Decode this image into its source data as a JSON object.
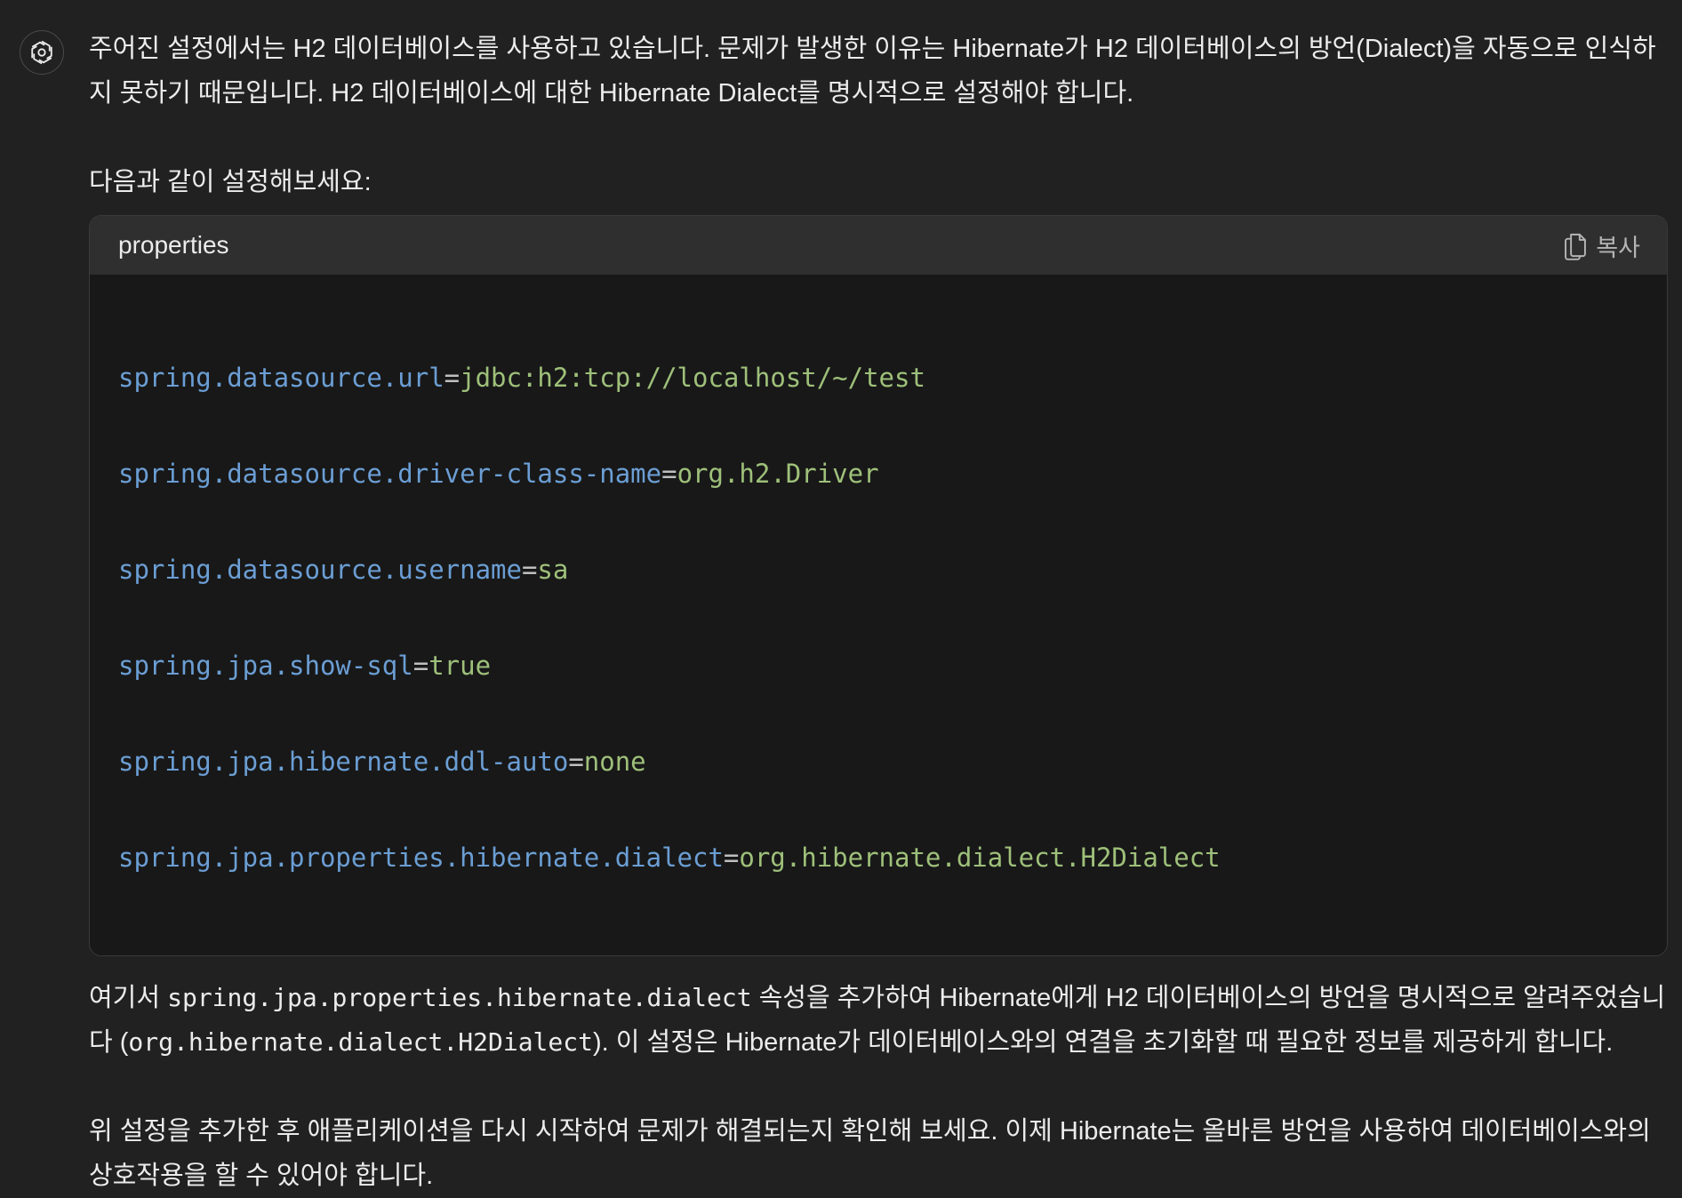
{
  "avatar": {
    "icon": "openai-logo-icon"
  },
  "message": {
    "para1": "주어진 설정에서는 H2 데이터베이스를 사용하고 있습니다. 문제가 발생한 이유는 Hibernate가 H2 데이터베이스의 방언(Dialect)을 자동으로 인식하지 못하기 때문입니다. H2 데이터베이스에 대한 Hibernate Dialect를 명시적으로 설정해야 합니다.",
    "para2": "다음과 같이 설정해보세요:",
    "para3_part1": "여기서 ",
    "para3_code1": "spring.jpa.properties.hibernate.dialect",
    "para3_part2": " 속성을 추가하여 Hibernate에게 H2 데이터베이스의 방언을 명시적으로 알려주었습니다 (",
    "para3_code2": "org.hibernate.dialect.H2Dialect",
    "para3_part3": "). 이 설정은 Hibernate가 데이터베이스와의 연결을 초기화할 때 필요한 정보를 제공하게 합니다.",
    "para4": "위 설정을 추가한 후 애플리케이션을 다시 시작하여 문제가 해결되는지 확인해 보세요. 이제 Hibernate는 올바른 방언을 사용하여 데이터베이스와의 상호작용을 할 수 있어야 합니다."
  },
  "code_block": {
    "language": "properties",
    "copy_label": "복사",
    "lines": [
      {
        "key": "spring.datasource.url",
        "eq": "=",
        "value": "jdbc:h2:tcp://localhost/~/test"
      },
      {
        "key": "spring.datasource.driver-class-name",
        "eq": "=",
        "value": "org.h2.Driver"
      },
      {
        "key": "spring.datasource.username",
        "eq": "=",
        "value": "sa"
      },
      {
        "key": "spring.jpa.show-sql",
        "eq": "=",
        "value": "true"
      },
      {
        "key": "spring.jpa.hibernate.ddl-auto",
        "eq": "=",
        "value": "none"
      },
      {
        "key": "spring.jpa.properties.hibernate.dialect",
        "eq": "=",
        "value": "org.hibernate.dialect.H2Dialect"
      }
    ]
  },
  "colors": {
    "background": "#212121",
    "code_key": "#6b9ed4",
    "code_value": "#9ec07a"
  }
}
